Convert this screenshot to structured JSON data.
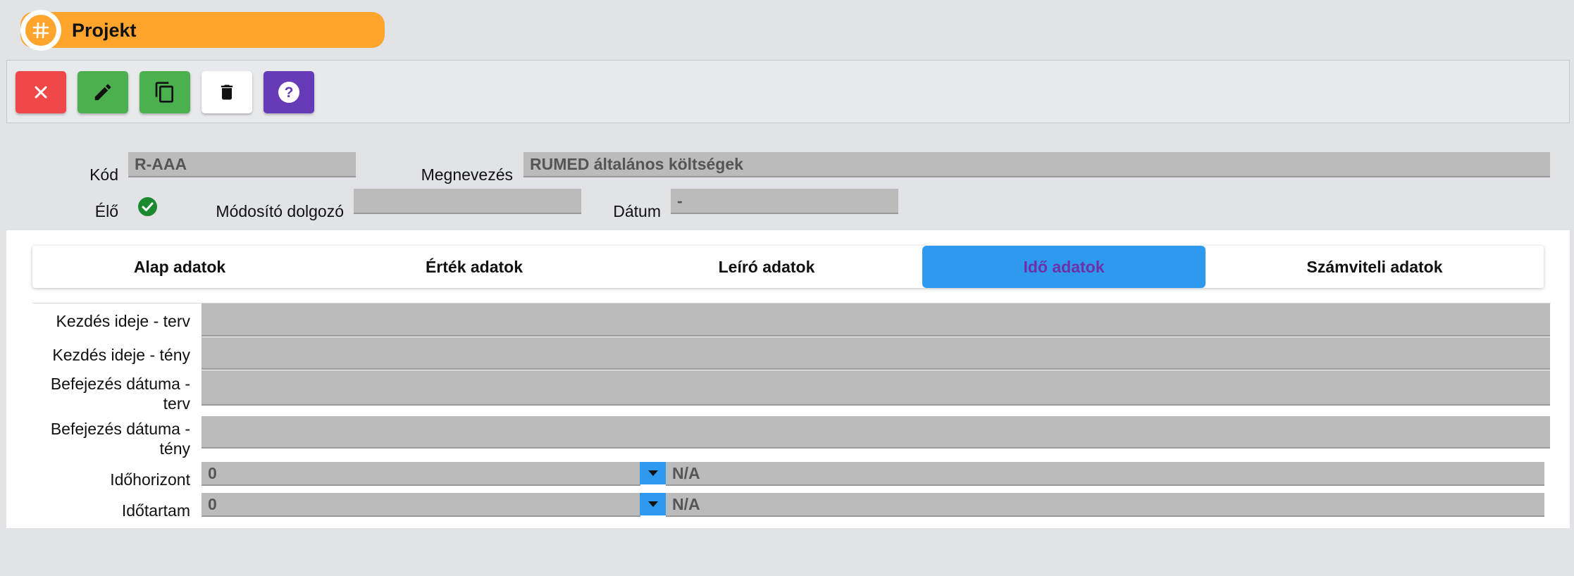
{
  "header": {
    "title": "Projekt",
    "icon": "hash-icon",
    "accent_color": "#ffa52e"
  },
  "toolbar": {
    "buttons": [
      {
        "name": "close",
        "icon": "close-icon",
        "color": "#f04848"
      },
      {
        "name": "edit",
        "icon": "pencil-icon",
        "color": "#4cb04f"
      },
      {
        "name": "copy",
        "icon": "copy-icon",
        "color": "#4cb04f"
      },
      {
        "name": "delete",
        "icon": "trash-icon",
        "color": "#ffffff"
      },
      {
        "name": "help",
        "icon": "help-icon",
        "color": "#673bb7"
      }
    ]
  },
  "summary": {
    "kod_label": "Kód",
    "kod_value": "R-AAA",
    "megnevezes_label": "Megnevezés",
    "megnevezes_value": "RUMED általános költségek",
    "elo_label": "Élő",
    "elo_checked": true,
    "modosito_label": "Módosító dolgozó",
    "modosito_value": "",
    "datum_label": "Dátum",
    "datum_value": "-"
  },
  "tabs": [
    {
      "label": "Alap adatok",
      "active": false
    },
    {
      "label": "Érték adatok",
      "active": false
    },
    {
      "label": "Leíró adatok",
      "active": false
    },
    {
      "label": "Idő adatok",
      "active": true
    },
    {
      "label": "Számviteli adatok",
      "active": false
    }
  ],
  "time_fields": {
    "kezdes_terv": {
      "label": "Kezdés ideje - terv",
      "value": ""
    },
    "kezdes_teny": {
      "label": "Kezdés ideje - tény",
      "value": ""
    },
    "befejezes_terv": {
      "label_line1": "Befejezés dátuma -",
      "label_line2": "terv",
      "value": ""
    },
    "befejezes_teny": {
      "label_line1": "Befejezés dátuma -",
      "label_line2": "tény",
      "value": ""
    },
    "idohorizont": {
      "label": "Időhorizont",
      "value": "0",
      "unit": "N/A"
    },
    "idotartam": {
      "label": "Időtartam",
      "value": "0",
      "unit": "N/A"
    }
  }
}
